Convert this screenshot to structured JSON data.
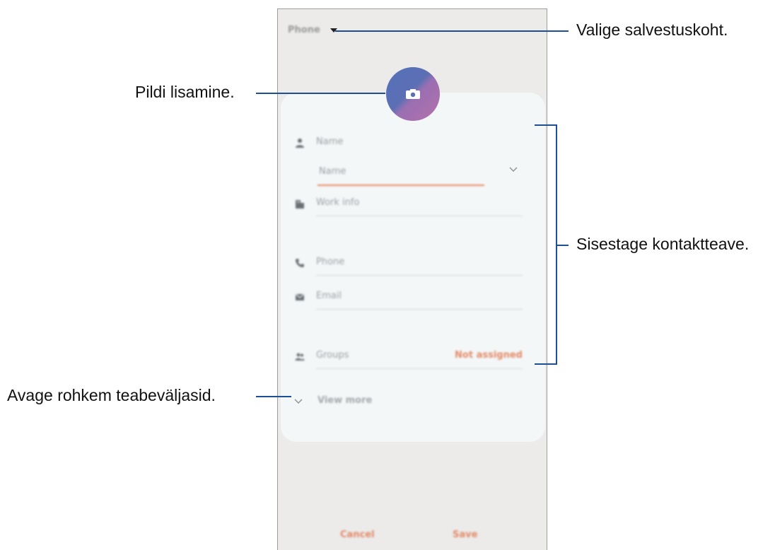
{
  "callouts": {
    "storage": "Valige salvestuskoht.",
    "photo": "Pildi lisamine.",
    "contact_info": "Sisestage kontaktteave.",
    "more_fields": "Avage rohkem teabeväljasid."
  },
  "screen": {
    "storage_label": "Phone",
    "fields": {
      "name": "Name",
      "name_sub": "Name",
      "work_info": "Work info",
      "phone": "Phone",
      "email": "Email",
      "groups": "Groups",
      "groups_value": "Not assigned"
    },
    "view_more": "View more",
    "cancel": "Cancel",
    "save": "Save"
  },
  "colors": {
    "accent": "#e38a68",
    "callout_line": "#1d4e96",
    "screen_bg": "#ecebea",
    "card_bg": "#f4f7f8"
  },
  "icons": {
    "storage": "chevron-down-icon",
    "photo": "camera-icon",
    "name": "person-icon",
    "work_info": "building-icon",
    "phone": "phone-icon",
    "email": "mail-icon",
    "groups": "people-icon",
    "view_more": "chevron-down-icon"
  }
}
